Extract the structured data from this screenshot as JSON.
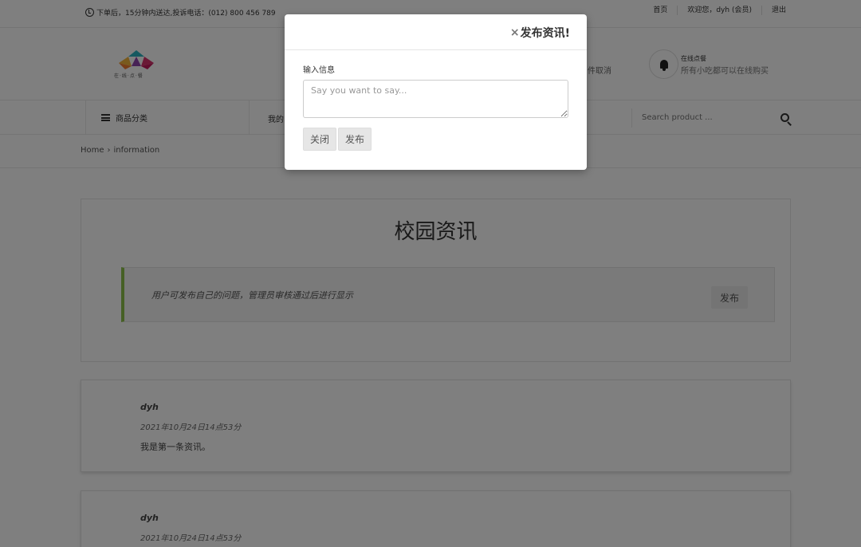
{
  "topbar": {
    "notice": "下单后，15分钟内送达,投诉电话：(012) 800 456 789",
    "links": [
      "首页",
      "欢迎您，dyh (会员)",
      "退出"
    ]
  },
  "header": {
    "logo_text": "在·线·点·餐",
    "promo_fragment": "件取消",
    "online_title": "在线点餐",
    "online_sub": "所有小吃都可以在线购买"
  },
  "nav": {
    "category_label": "商品分类",
    "my_link": "我的",
    "search_placeholder": "Search product ..."
  },
  "breadcrumb": {
    "home": "Home",
    "separator": "›",
    "current": "information"
  },
  "main": {
    "title": "校园资讯",
    "info_message": "用户可发布自己的问题，管理员审核通过后进行显示",
    "publish_label": "发布",
    "accent_color": "#8cc04a"
  },
  "posts": [
    {
      "author": "dyh",
      "time": "2021年10月24日14点53分",
      "content": "我是第一条资讯。"
    },
    {
      "author": "dyh",
      "time": "2021年10月24日14点53分",
      "content": ""
    }
  ],
  "modal": {
    "close_glyph": "×",
    "title": "发布资讯!",
    "label": "输入信息",
    "placeholder": "Say you want to say...",
    "close_button": "关闭",
    "submit_button": "发布"
  }
}
